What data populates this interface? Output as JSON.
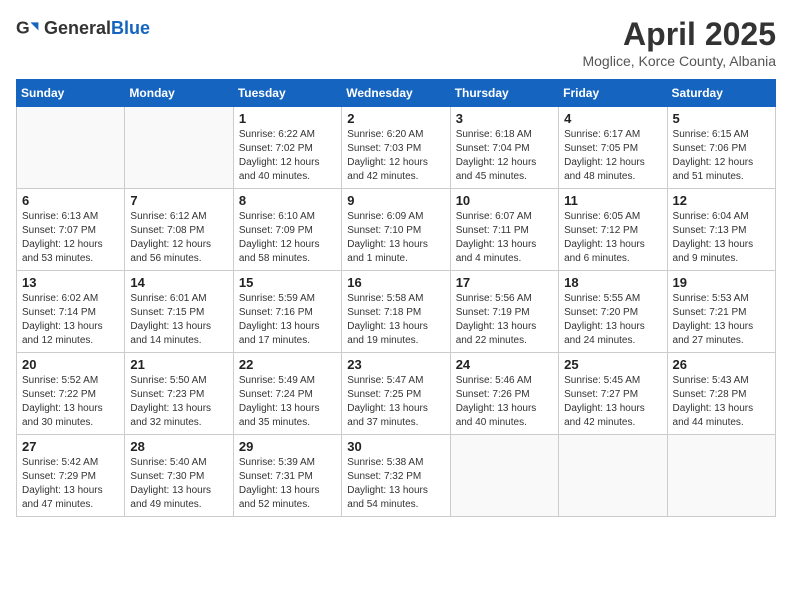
{
  "header": {
    "logo_general": "General",
    "logo_blue": "Blue",
    "month": "April 2025",
    "location": "Moglice, Korce County, Albania"
  },
  "weekdays": [
    "Sunday",
    "Monday",
    "Tuesday",
    "Wednesday",
    "Thursday",
    "Friday",
    "Saturday"
  ],
  "weeks": [
    [
      {
        "day": "",
        "info": ""
      },
      {
        "day": "",
        "info": ""
      },
      {
        "day": "1",
        "info": "Sunrise: 6:22 AM\nSunset: 7:02 PM\nDaylight: 12 hours and 40 minutes."
      },
      {
        "day": "2",
        "info": "Sunrise: 6:20 AM\nSunset: 7:03 PM\nDaylight: 12 hours and 42 minutes."
      },
      {
        "day": "3",
        "info": "Sunrise: 6:18 AM\nSunset: 7:04 PM\nDaylight: 12 hours and 45 minutes."
      },
      {
        "day": "4",
        "info": "Sunrise: 6:17 AM\nSunset: 7:05 PM\nDaylight: 12 hours and 48 minutes."
      },
      {
        "day": "5",
        "info": "Sunrise: 6:15 AM\nSunset: 7:06 PM\nDaylight: 12 hours and 51 minutes."
      }
    ],
    [
      {
        "day": "6",
        "info": "Sunrise: 6:13 AM\nSunset: 7:07 PM\nDaylight: 12 hours and 53 minutes."
      },
      {
        "day": "7",
        "info": "Sunrise: 6:12 AM\nSunset: 7:08 PM\nDaylight: 12 hours and 56 minutes."
      },
      {
        "day": "8",
        "info": "Sunrise: 6:10 AM\nSunset: 7:09 PM\nDaylight: 12 hours and 58 minutes."
      },
      {
        "day": "9",
        "info": "Sunrise: 6:09 AM\nSunset: 7:10 PM\nDaylight: 13 hours and 1 minute."
      },
      {
        "day": "10",
        "info": "Sunrise: 6:07 AM\nSunset: 7:11 PM\nDaylight: 13 hours and 4 minutes."
      },
      {
        "day": "11",
        "info": "Sunrise: 6:05 AM\nSunset: 7:12 PM\nDaylight: 13 hours and 6 minutes."
      },
      {
        "day": "12",
        "info": "Sunrise: 6:04 AM\nSunset: 7:13 PM\nDaylight: 13 hours and 9 minutes."
      }
    ],
    [
      {
        "day": "13",
        "info": "Sunrise: 6:02 AM\nSunset: 7:14 PM\nDaylight: 13 hours and 12 minutes."
      },
      {
        "day": "14",
        "info": "Sunrise: 6:01 AM\nSunset: 7:15 PM\nDaylight: 13 hours and 14 minutes."
      },
      {
        "day": "15",
        "info": "Sunrise: 5:59 AM\nSunset: 7:16 PM\nDaylight: 13 hours and 17 minutes."
      },
      {
        "day": "16",
        "info": "Sunrise: 5:58 AM\nSunset: 7:18 PM\nDaylight: 13 hours and 19 minutes."
      },
      {
        "day": "17",
        "info": "Sunrise: 5:56 AM\nSunset: 7:19 PM\nDaylight: 13 hours and 22 minutes."
      },
      {
        "day": "18",
        "info": "Sunrise: 5:55 AM\nSunset: 7:20 PM\nDaylight: 13 hours and 24 minutes."
      },
      {
        "day": "19",
        "info": "Sunrise: 5:53 AM\nSunset: 7:21 PM\nDaylight: 13 hours and 27 minutes."
      }
    ],
    [
      {
        "day": "20",
        "info": "Sunrise: 5:52 AM\nSunset: 7:22 PM\nDaylight: 13 hours and 30 minutes."
      },
      {
        "day": "21",
        "info": "Sunrise: 5:50 AM\nSunset: 7:23 PM\nDaylight: 13 hours and 32 minutes."
      },
      {
        "day": "22",
        "info": "Sunrise: 5:49 AM\nSunset: 7:24 PM\nDaylight: 13 hours and 35 minutes."
      },
      {
        "day": "23",
        "info": "Sunrise: 5:47 AM\nSunset: 7:25 PM\nDaylight: 13 hours and 37 minutes."
      },
      {
        "day": "24",
        "info": "Sunrise: 5:46 AM\nSunset: 7:26 PM\nDaylight: 13 hours and 40 minutes."
      },
      {
        "day": "25",
        "info": "Sunrise: 5:45 AM\nSunset: 7:27 PM\nDaylight: 13 hours and 42 minutes."
      },
      {
        "day": "26",
        "info": "Sunrise: 5:43 AM\nSunset: 7:28 PM\nDaylight: 13 hours and 44 minutes."
      }
    ],
    [
      {
        "day": "27",
        "info": "Sunrise: 5:42 AM\nSunset: 7:29 PM\nDaylight: 13 hours and 47 minutes."
      },
      {
        "day": "28",
        "info": "Sunrise: 5:40 AM\nSunset: 7:30 PM\nDaylight: 13 hours and 49 minutes."
      },
      {
        "day": "29",
        "info": "Sunrise: 5:39 AM\nSunset: 7:31 PM\nDaylight: 13 hours and 52 minutes."
      },
      {
        "day": "30",
        "info": "Sunrise: 5:38 AM\nSunset: 7:32 PM\nDaylight: 13 hours and 54 minutes."
      },
      {
        "day": "",
        "info": ""
      },
      {
        "day": "",
        "info": ""
      },
      {
        "day": "",
        "info": ""
      }
    ]
  ]
}
